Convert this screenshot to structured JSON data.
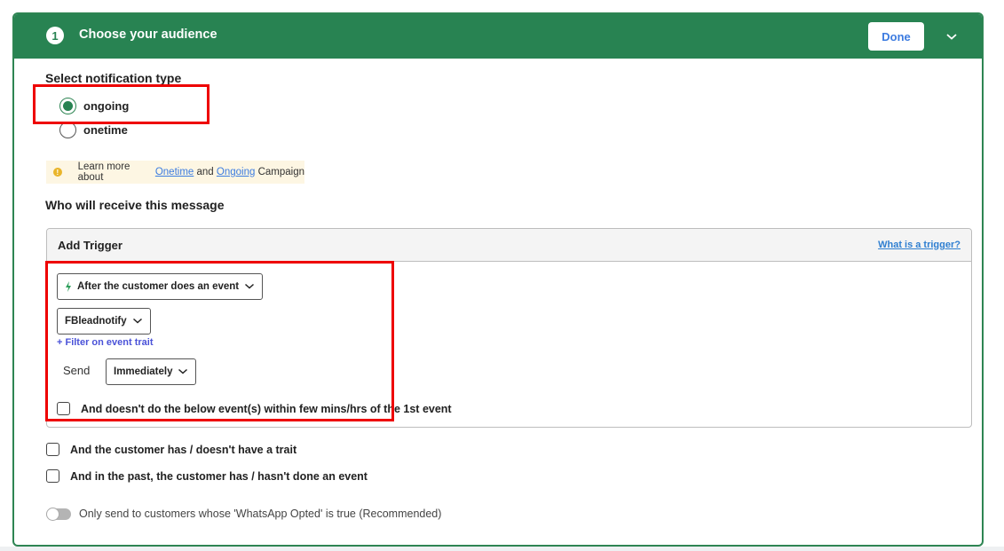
{
  "header": {
    "step_number": "1",
    "title": "Choose your audience",
    "done_label": "Done",
    "collapse_icon": "chevron-down-icon"
  },
  "notification_type": {
    "label": "Select notification type",
    "options": [
      {
        "label": "ongoing",
        "selected": true
      },
      {
        "label": "onetime",
        "selected": false
      }
    ]
  },
  "info": {
    "icon": "info-icon",
    "prefix": "Learn more about ",
    "link1": "Onetime",
    "middle": " and ",
    "link2": "Ongoing",
    "suffix": " Campaign"
  },
  "recipients": {
    "label": "Who will receive this message"
  },
  "trigger": {
    "title": "Add Trigger",
    "help_link": "What is a trigger?",
    "event_type_dropdown": "After the customer does an event",
    "event_dropdown": "FBleadnotify",
    "filter_link": "+ Filter on event trait",
    "send_label": "Send",
    "send_dropdown": "Immediately",
    "negation_checkbox": {
      "label": "And doesn't do the below event(s) within few mins/hrs of the 1st event",
      "checked": false
    }
  },
  "conditions": [
    {
      "label": "And the customer has / doesn't have a trait",
      "checked": false
    },
    {
      "label": "And in the past, the customer has / hasn't done an event",
      "checked": false
    }
  ],
  "whatsapp_toggle": {
    "label": "Only send to customers whose 'WhatsApp Opted' is true (Recommended)",
    "on": false
  },
  "colors": {
    "brand_green": "#288352",
    "link_blue": "#2f7fd1",
    "highlight_red": "#ee0000"
  }
}
